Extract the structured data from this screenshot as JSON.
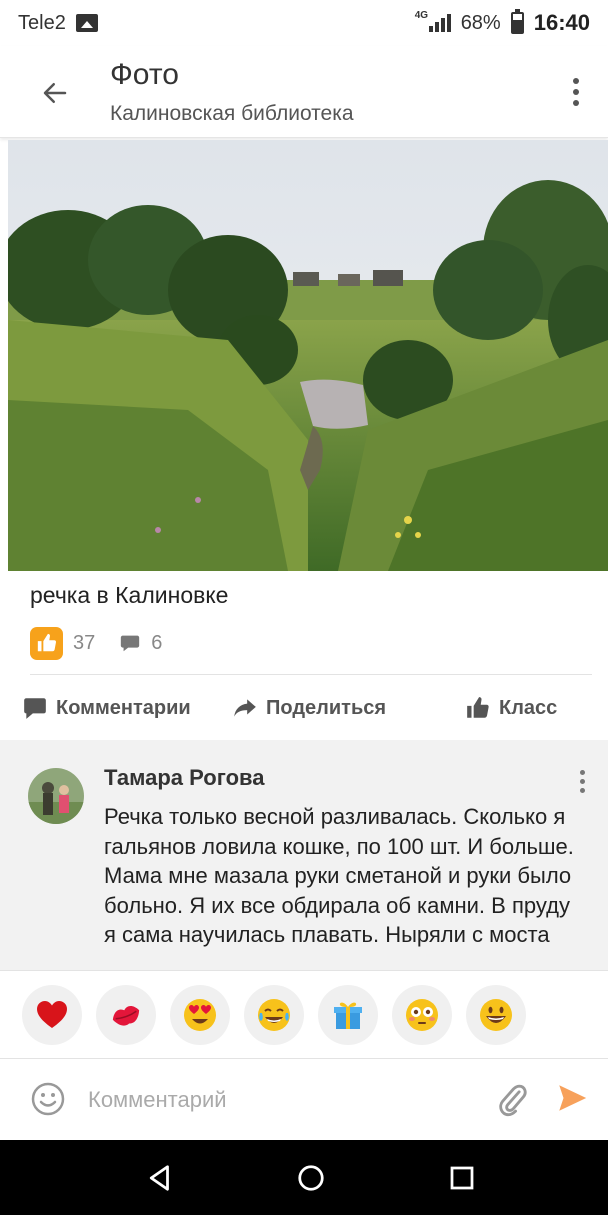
{
  "status_bar": {
    "carrier": "Tele2",
    "network": "4G",
    "battery": "68%",
    "battery_level": 0.68,
    "time": "16:40"
  },
  "app_bar": {
    "title": "Фото",
    "subtitle": "Калиновская библиотека"
  },
  "photo": {
    "caption": "речка в Калиновке"
  },
  "stats": {
    "likes": "37",
    "comments": "6"
  },
  "actions": {
    "comments_label": "Комментарии",
    "share_label": "Поделиться",
    "klass_label": "Класс"
  },
  "comment": {
    "author": "Тамара Рогова",
    "text": "Речка только весной разливалась. Сколько я гальянов ловила кошке, по 100 шт. И больше. Мама мне мазала руки сметаной и руки было больно. Я их все обдирала об камни. В пруду я сама научилась плавать. Ныряли с моста"
  },
  "reactions": [
    {
      "name": "heart-emoji",
      "color": "#d8141a"
    },
    {
      "name": "kiss-lips-emoji",
      "color": "#e3163a"
    },
    {
      "name": "heart-eyes-emoji",
      "color": "#f7c21b"
    },
    {
      "name": "tears-of-joy-emoji",
      "color": "#f7c21b"
    },
    {
      "name": "gift-emoji",
      "color": "#3a9be0"
    },
    {
      "name": "flushed-face-emoji",
      "color": "#f7c21b"
    },
    {
      "name": "grinning-face-emoji",
      "color": "#f7c21b"
    }
  ],
  "input": {
    "placeholder": "Комментарий"
  },
  "colors": {
    "accent_orange": "#f7a21b",
    "send_orange": "#f7a15b"
  }
}
